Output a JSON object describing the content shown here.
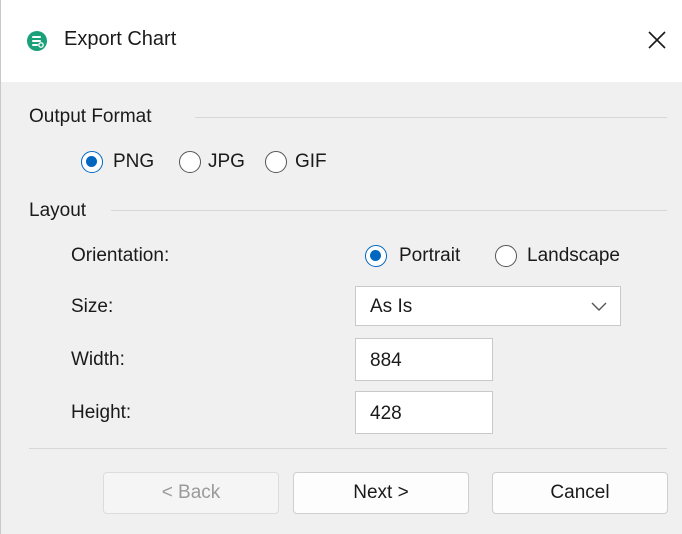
{
  "window": {
    "title": "Export Chart"
  },
  "output_format": {
    "label": "Output Format",
    "options": [
      {
        "label": "PNG",
        "checked": true
      },
      {
        "label": "JPG",
        "checked": false
      },
      {
        "label": "GIF",
        "checked": false
      }
    ]
  },
  "layout": {
    "label": "Layout",
    "orientation": {
      "label": "Orientation:",
      "options": [
        {
          "label": "Portrait",
          "checked": true
        },
        {
          "label": "Landscape",
          "checked": false
        }
      ]
    },
    "size": {
      "label": "Size:",
      "value": "As Is"
    },
    "width": {
      "label": "Width:",
      "value": "884"
    },
    "height": {
      "label": "Height:",
      "value": "428"
    }
  },
  "buttons": {
    "back": "< Back",
    "next": "Next >",
    "cancel": "Cancel"
  },
  "colors": {
    "accent": "#0067c0",
    "app_icon": "#1aa179"
  },
  "icons": {
    "app": "chart-app-icon",
    "close": "close-icon",
    "dropdown": "chevron-down-icon"
  }
}
